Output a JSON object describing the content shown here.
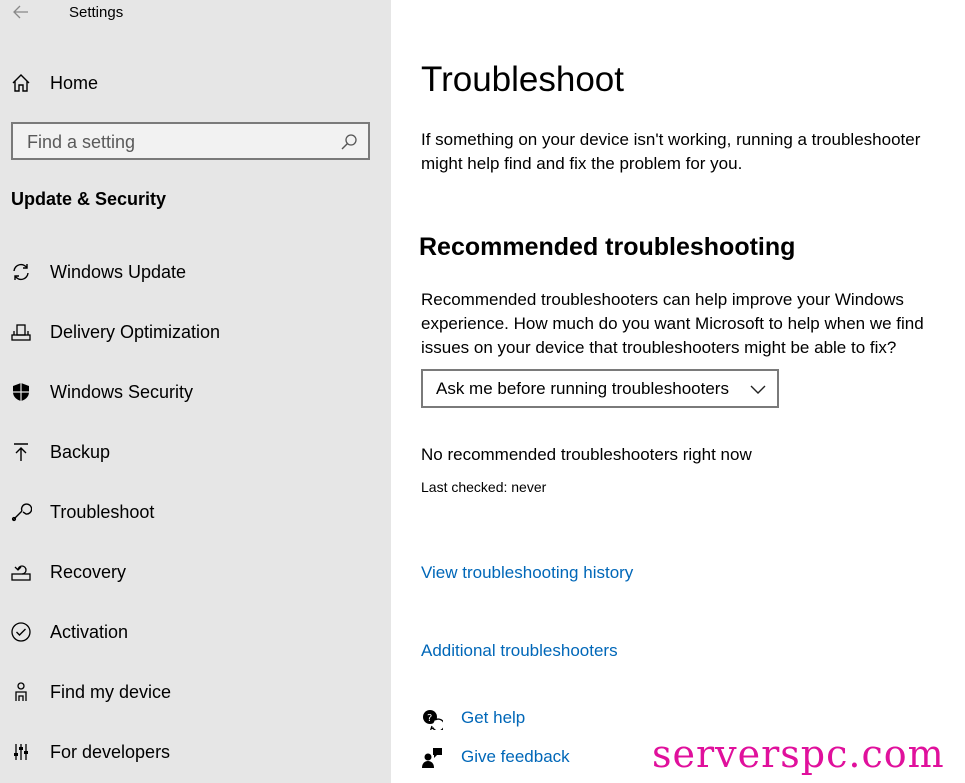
{
  "window": {
    "title": "Settings"
  },
  "sidebar": {
    "home_label": "Home",
    "search_placeholder": "Find a setting",
    "section_title": "Update & Security",
    "items": [
      {
        "label": "Windows Update",
        "icon": "sync-icon"
      },
      {
        "label": "Delivery Optimization",
        "icon": "delivery-optimization-icon"
      },
      {
        "label": "Windows Security",
        "icon": "shield-icon"
      },
      {
        "label": "Backup",
        "icon": "backup-arrow-icon"
      },
      {
        "label": "Troubleshoot",
        "icon": "wrench-icon"
      },
      {
        "label": "Recovery",
        "icon": "recovery-icon"
      },
      {
        "label": "Activation",
        "icon": "check-circle-icon"
      },
      {
        "label": "Find my device",
        "icon": "person-location-icon"
      },
      {
        "label": "For developers",
        "icon": "developer-sliders-icon"
      }
    ]
  },
  "main": {
    "title": "Troubleshoot",
    "intro": "If something on your device isn't working, running a troubleshooter might help find and fix the problem for you.",
    "recommended": {
      "heading": "Recommended troubleshooting",
      "description": "Recommended troubleshooters can help improve your Windows experience. How much do you want Microsoft to help when we find issues on your device that troubleshooters might be able to fix?",
      "dropdown_value": "Ask me before running troubleshooters",
      "status": "No recommended troubleshooters right now",
      "last_checked": "Last checked: never"
    },
    "links": {
      "history": "View troubleshooting history",
      "additional": "Additional troubleshooters"
    },
    "help": {
      "get_help": "Get help",
      "give_feedback": "Give feedback"
    }
  },
  "watermark": "serverspc.com",
  "colors": {
    "sidebar_bg": "#e6e6e6",
    "link": "#0067b8",
    "watermark": "#e0109c"
  }
}
